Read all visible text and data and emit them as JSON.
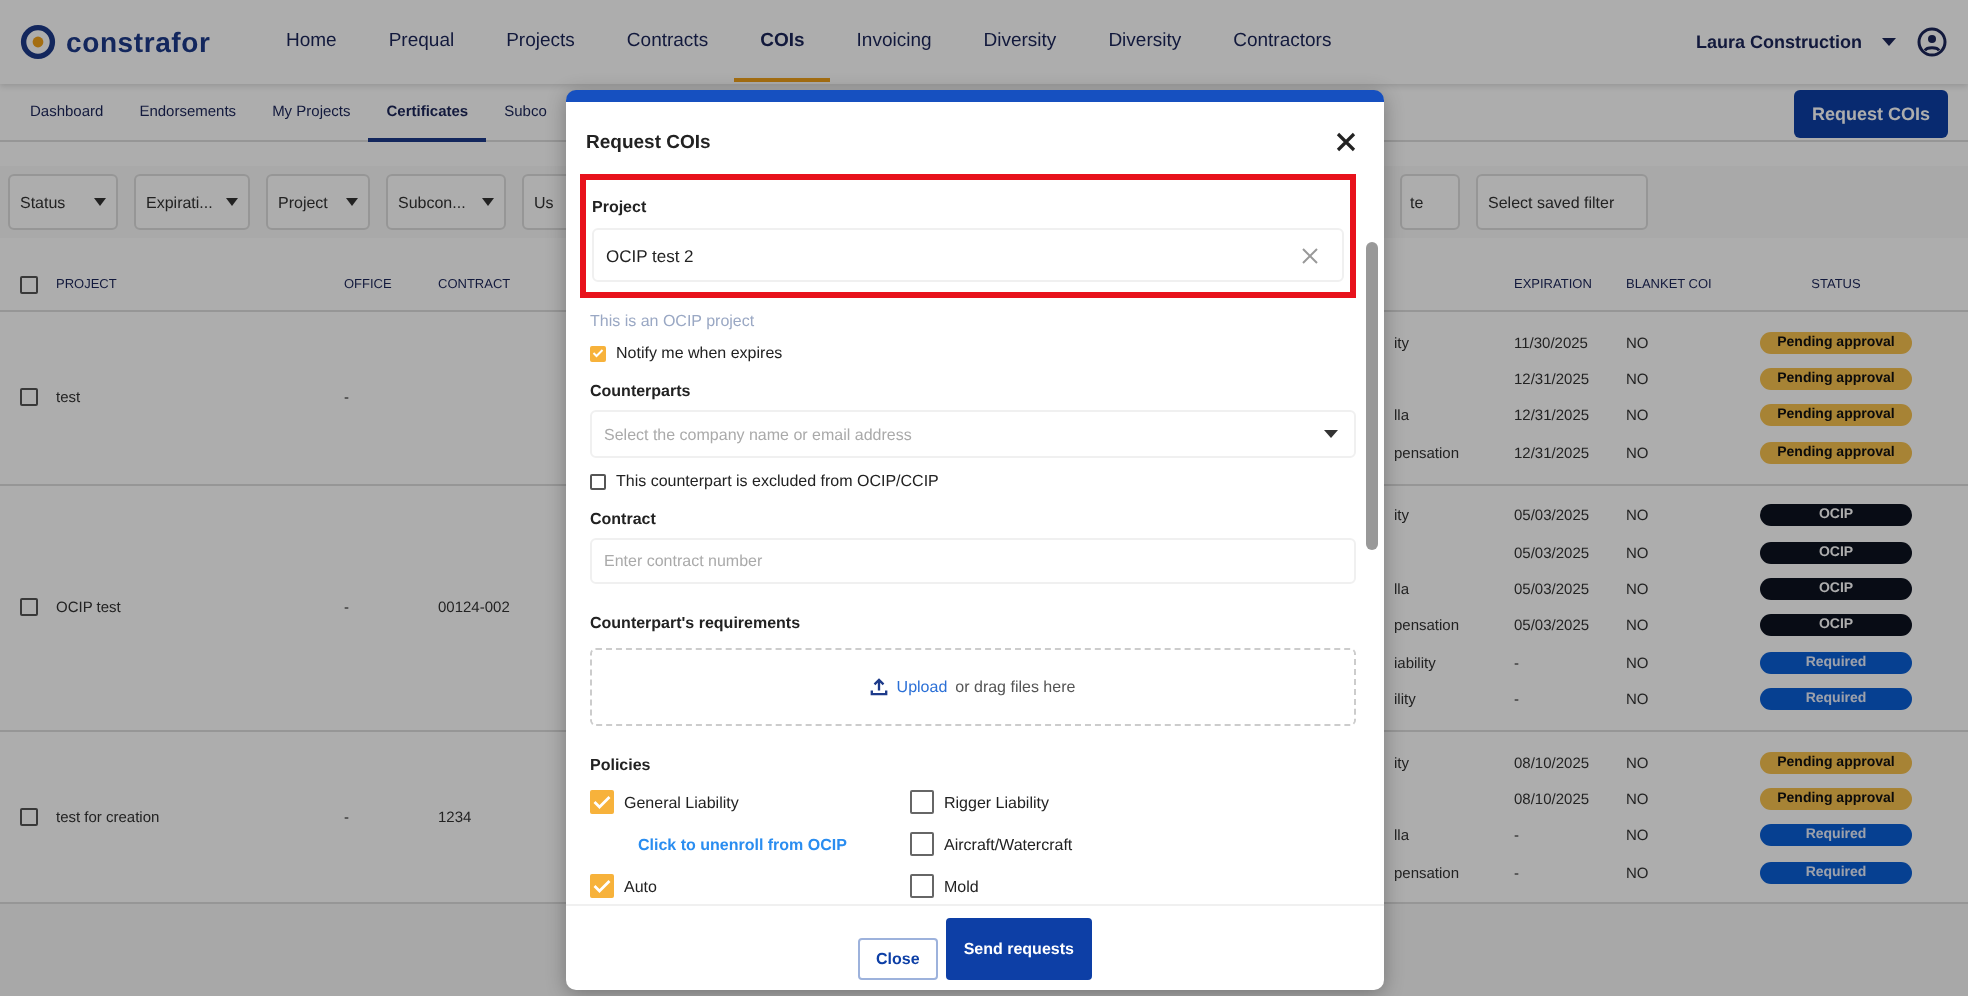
{
  "nav": {
    "logo": "constrafor",
    "account": "Laura Construction",
    "items": [
      {
        "label": "Home",
        "selected": false
      },
      {
        "label": "Prequal",
        "selected": false
      },
      {
        "label": "Projects",
        "selected": false
      },
      {
        "label": "Contracts",
        "selected": false
      },
      {
        "label": "COIs",
        "selected": true
      },
      {
        "label": "Invoicing",
        "selected": false
      },
      {
        "label": "Diversity",
        "selected": false
      },
      {
        "label": "Diversity",
        "selected": false
      },
      {
        "label": "Contractors",
        "selected": false
      }
    ]
  },
  "subtabs": [
    {
      "label": "Dashboard",
      "selected": false
    },
    {
      "label": "Endorsements",
      "selected": false
    },
    {
      "label": "My Projects",
      "selected": false
    },
    {
      "label": "Certificates",
      "selected": true
    },
    {
      "label": "Subco",
      "selected": false
    }
  ],
  "request_button": "Request COIs",
  "filters_left": [
    {
      "label": "Status",
      "caret": true
    },
    {
      "label": "Expirati...",
      "caret": true
    },
    {
      "label": "Project",
      "caret": true
    },
    {
      "label": "Subcon...",
      "caret": true
    },
    {
      "label": "Us",
      "caret": false
    }
  ],
  "filters_right": [
    {
      "label": "te",
      "caret": false
    },
    {
      "label": "Select saved filter",
      "caret": false
    }
  ],
  "table": {
    "select_all_checked": false,
    "columns_left": [
      "PROJECT",
      "OFFICE",
      "CONTRACT"
    ],
    "columns_right": [
      "EXPIRATION",
      "BLANKET COI",
      "STATUS"
    ],
    "groups": [
      {
        "checked": false,
        "project": "test",
        "office": "-",
        "rows": [
          {
            "policy": "ity",
            "expiration": "11/30/2025",
            "blanket": "NO",
            "status": {
              "label": "Pending approval",
              "kind": "pending"
            }
          },
          {
            "expiration": "12/31/2025",
            "blanket": "NO",
            "status": {
              "label": "Pending approval",
              "kind": "pending"
            }
          },
          {
            "policy": "lla",
            "expiration": "12/31/2025",
            "blanket": "NO",
            "status": {
              "label": "Pending approval",
              "kind": "pending"
            }
          },
          {
            "policy": "pensation",
            "expiration": "12/31/2025",
            "blanket": "NO",
            "status": {
              "label": "Pending approval",
              "kind": "pending"
            }
          }
        ]
      },
      {
        "checked": false,
        "project": "OCIP test",
        "office": "-",
        "contract": "00124-002",
        "rows": [
          {
            "policy": "ity",
            "expiration": "05/03/2025",
            "blanket": "NO",
            "status": {
              "label": "OCIP",
              "kind": "ocip"
            }
          },
          {
            "expiration": "05/03/2025",
            "blanket": "NO",
            "status": {
              "label": "OCIP",
              "kind": "ocip"
            }
          },
          {
            "policy": "lla",
            "expiration": "05/03/2025",
            "blanket": "NO",
            "status": {
              "label": "OCIP",
              "kind": "ocip"
            }
          },
          {
            "policy": "pensation",
            "expiration": "05/03/2025",
            "blanket": "NO",
            "status": {
              "label": "OCIP",
              "kind": "ocip"
            }
          },
          {
            "policy": "iability",
            "expiration": "-",
            "blanket": "NO",
            "status": {
              "label": "Required",
              "kind": "required"
            }
          },
          {
            "policy": "ility",
            "expiration": "-",
            "blanket": "NO",
            "status": {
              "label": "Required",
              "kind": "required"
            }
          }
        ]
      },
      {
        "checked": false,
        "project": "test for creation",
        "office": "-",
        "contract": "1234",
        "rows": [
          {
            "policy": "ity",
            "expiration": "08/10/2025",
            "blanket": "NO",
            "status": {
              "label": "Pending approval",
              "kind": "pending"
            }
          },
          {
            "expiration": "08/10/2025",
            "blanket": "NO",
            "status": {
              "label": "Pending approval",
              "kind": "pending"
            }
          },
          {
            "policy": "lla",
            "expiration": "-",
            "blanket": "NO",
            "status": {
              "label": "Required",
              "kind": "required"
            }
          },
          {
            "policy": "pensation",
            "expiration": "-",
            "blanket": "NO",
            "status": {
              "label": "Required",
              "kind": "required"
            }
          }
        ]
      }
    ]
  },
  "modal": {
    "title": "Request COIs",
    "project": {
      "label": "Project",
      "value": "OCIP test 2",
      "highlighted": true
    },
    "ocip_note": "This is an OCIP project",
    "notify": {
      "label": "Notify me when expires",
      "checked": true
    },
    "counterparts": {
      "label": "Counterparts",
      "placeholder": "Select the company name or email address"
    },
    "excluded": {
      "label": "This counterpart is excluded from OCIP/CCIP",
      "checked": false
    },
    "contract": {
      "label": "Contract",
      "placeholder": "Enter contract number"
    },
    "requirements": {
      "label": "Counterpart's requirements",
      "upload_link": "Upload",
      "upload_text": "or drag files here"
    },
    "policies": {
      "label": "Policies",
      "left": [
        {
          "kind": "checkbox",
          "label": "General Liability",
          "checked": true
        },
        {
          "kind": "link",
          "label": "Click to unenroll from OCIP"
        },
        {
          "kind": "checkbox",
          "label": "Auto",
          "checked": true
        }
      ],
      "right": [
        {
          "kind": "checkbox",
          "label": "Rigger Liability",
          "checked": false
        },
        {
          "kind": "checkbox",
          "label": "Aircraft/Watercraft",
          "checked": false
        },
        {
          "kind": "checkbox",
          "label": "Mold",
          "checked": false
        }
      ]
    },
    "buttons": [
      {
        "label": "Close",
        "kind": "secondary"
      },
      {
        "label": "Send requests",
        "kind": "primary"
      }
    ]
  }
}
